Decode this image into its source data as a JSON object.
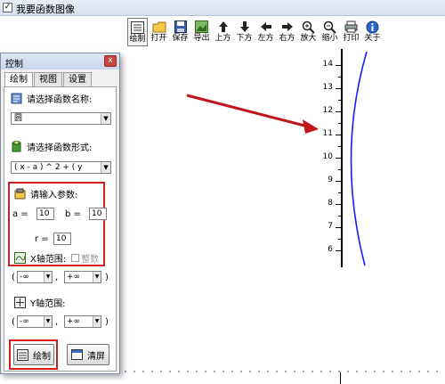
{
  "window": {
    "title": "我要函数图像"
  },
  "toolbar": {
    "items": [
      {
        "label": "绘制",
        "icon": "grid-icon"
      },
      {
        "label": "打开",
        "icon": "folder-icon"
      },
      {
        "label": "保存",
        "icon": "floppy-icon"
      },
      {
        "label": "导出",
        "icon": "image-export-icon"
      },
      {
        "label": "上方",
        "icon": "arrow-up-icon"
      },
      {
        "label": "下方",
        "icon": "arrow-down-icon"
      },
      {
        "label": "左方",
        "icon": "arrow-left-icon"
      },
      {
        "label": "右方",
        "icon": "arrow-right-icon"
      },
      {
        "label": "放大",
        "icon": "zoom-in-icon"
      },
      {
        "label": "缩小",
        "icon": "zoom-out-icon"
      },
      {
        "label": "打印",
        "icon": "printer-icon"
      },
      {
        "label": "关于",
        "icon": "info-icon"
      }
    ]
  },
  "panel": {
    "title": "控制",
    "close_glyph": "x",
    "tabs": [
      "绘制",
      "视图",
      "设置"
    ],
    "function_name_label": "请选择函数名称:",
    "function_name_value": "圆",
    "function_form_label": "请选择函数形式:",
    "function_form_value": "( x - a ) ^ 2 + ( y",
    "params_label": "请输入参数:",
    "params": {
      "a_label": "a =",
      "a_value": "10",
      "b_label": "b =",
      "b_value": "10",
      "r_label": "r =",
      "r_value": "10"
    },
    "x_range_label": "X轴范围:",
    "integer_label": "整数",
    "x_range": {
      "open": "(",
      "min": "-∞",
      "sep": ",",
      "max": "+∞",
      "close": ")"
    },
    "y_range_label": "Y轴范围:",
    "y_range": {
      "open": "(",
      "min": "-∞",
      "sep": ",",
      "max": "+∞",
      "close": ")"
    },
    "draw_button": "绘制",
    "clear_button": "清屏"
  },
  "graph": {
    "y_ticks": [
      "14",
      "13",
      "12",
      "11",
      "10",
      "9",
      "8",
      "7",
      "6"
    ],
    "curve_color": "#1a1aff",
    "arrow_color": "#c0151b",
    "highlight_color": "#d02020"
  }
}
